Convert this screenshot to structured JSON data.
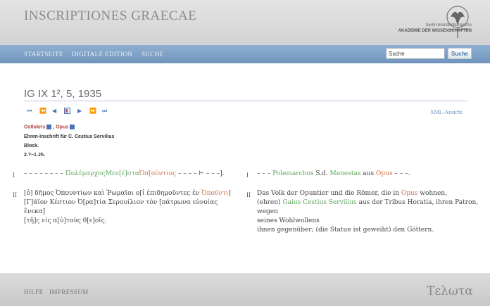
{
  "header": {
    "site_title": "INSCRIPTIONES GRAECAE",
    "logo_line1": "berlin-brandenburgische",
    "logo_line2": "AKADEMIE DER WISSENSCHAFTEN"
  },
  "nav": {
    "items": [
      "STARTSEITE",
      "DIGITALE EDITION",
      "SUCHE"
    ],
    "search": {
      "value": "Suche",
      "button_label": "Suche"
    }
  },
  "document": {
    "title": "IG IX 1², 5, 1935",
    "xml_link": "XML-Ansicht",
    "meta": {
      "region": "Ostlokris",
      "separator": ",",
      "place": "Opus",
      "description": "Ehren-Inschrift für C. Cestius Servilius",
      "object": "Block.",
      "date": "2.?–1.Jh."
    },
    "rows": [
      {
        "num": "I",
        "greek": [
          "– – – – – – – – ",
          "Πολέμαρχος",
          "Μεν[έ]στα",
          "Ὀπ[ούντιος",
          " – – – – ⊢ – – –]."
        ],
        "german_num": "I",
        "german": [
          "– – – ",
          "Polemarchos",
          " S.d. ",
          "Menestas",
          " aus ",
          "Opus",
          " – – –."
        ]
      },
      {
        "num": "II",
        "greek_lines": [
          [
            "[ὁ] δῆμος Ὀπουντίων καὶ Ῥωμαῖοι ο[ἱ ἐπιδημοῦντες ἐν ",
            "Ὀποῦντι",
            "]"
          ],
          [
            "[Γ]άϊον Κέστιον Ὀ[ρα]τία Σερουίλιον τὸν [πάτρωνα εὐνοίας ἕνεκα]"
          ],
          [
            "[τῆ]ς εἰς α[ὑ]τοὺς θ[ε]οῖς."
          ]
        ],
        "german_num": "II",
        "german_lines": [
          [
            "Das Volk der Opuntier und die Römer, die in ",
            "Opus",
            " wohnen,"
          ],
          [
            "(ehren) ",
            "Gaius Cestius Servilius",
            " aus der Tribus Horatia, ihren Patron, wegen"
          ],
          [
            "seines Wohlwollens"
          ],
          [
            "ihnen gegenüber; (die Statue ist geweiht) den Göttern."
          ]
        ]
      }
    ]
  },
  "footer": {
    "items": [
      "HILFE",
      "IMPRESSUM"
    ],
    "brand": "Τελωτα"
  },
  "icons": [
    "first-page-icon",
    "prev-fast-icon",
    "prev-icon",
    "overview-icon",
    "next-icon",
    "next-fast-icon",
    "last-page-icon",
    "info-icon"
  ]
}
